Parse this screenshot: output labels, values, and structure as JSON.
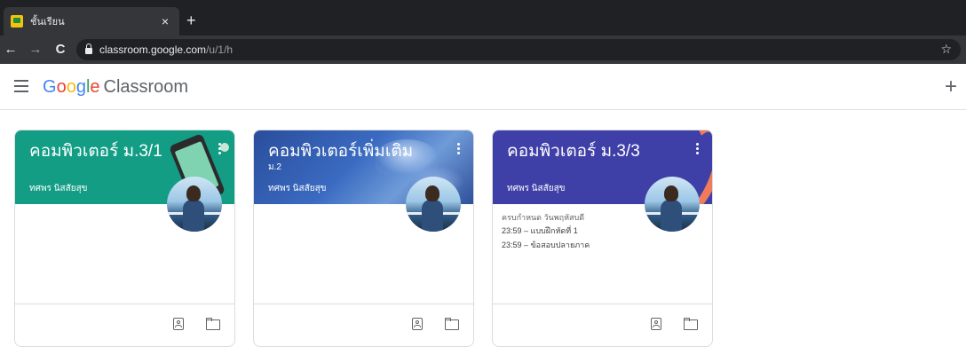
{
  "browser": {
    "tab_title": "ชั้นเรียน",
    "tab_close": "×",
    "new_tab": "+",
    "back": "←",
    "forward": "→",
    "reload": "C",
    "url_host": "classroom.google.com",
    "url_path": "/u/1/h",
    "bookmark": "☆"
  },
  "app": {
    "brand_letters": [
      "G",
      "o",
      "o",
      "g",
      "l",
      "e"
    ],
    "product": "Classroom",
    "create_join": "+"
  },
  "cards": [
    {
      "title": "คอมพิวเตอร์ ม.3/1",
      "section": "",
      "teacher": "ทศพร นิสสัยสุข",
      "due_header": "",
      "due_items": []
    },
    {
      "title": "คอมพิวเตอร์เพิ่มเติม",
      "section": "ม.2",
      "teacher": "ทศพร นิสสัยสุข",
      "due_header": "",
      "due_items": []
    },
    {
      "title": "คอมพิวเตอร์ ม.3/3",
      "section": "",
      "teacher": "ทศพร นิสสัยสุข",
      "due_header": "ครบกำหนด วันพฤหัสบดี",
      "due_items": [
        "23:59 – แบบฝึกหัดที่ 1",
        "23:59 – ข้อสอบปลายภาค"
      ]
    }
  ],
  "colors": {
    "card1_header": "#129d84",
    "card2_header": "#3a6bc1",
    "card3_header": "#3f3fa8",
    "chrome_dark": "#202124"
  },
  "icons": [
    "tab-favicon-icon",
    "lock-icon",
    "star-icon",
    "menu-icon",
    "kebab-icon",
    "portfolio-icon",
    "folder-icon"
  ]
}
